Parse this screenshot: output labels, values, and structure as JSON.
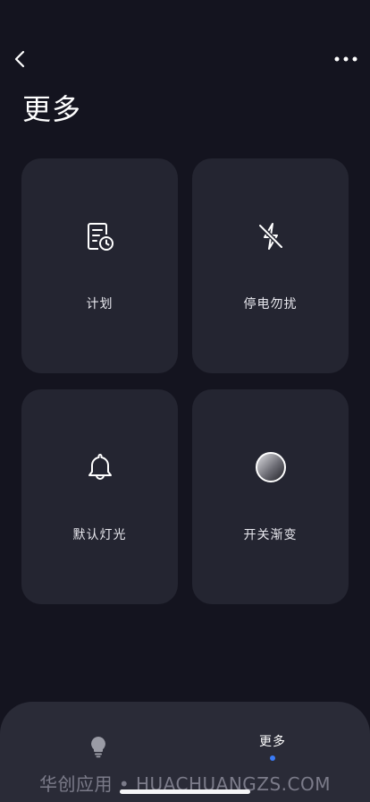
{
  "header": {
    "title": "更多"
  },
  "cards": [
    {
      "label": "计划",
      "icon": "schedule-document-clock-icon"
    },
    {
      "label": "停电勿扰",
      "icon": "power-off-bolt-slash-icon"
    },
    {
      "label": "默认灯光",
      "icon": "bell-icon"
    },
    {
      "label": "开关渐变",
      "icon": "gradient-circle-icon"
    }
  ],
  "bottom_tabs": {
    "light_icon": "bulb-icon",
    "more_label": "更多",
    "active_dot_color": "#3a7bf6"
  },
  "watermark": "华创应用 • HUACHUANGZS.COM"
}
